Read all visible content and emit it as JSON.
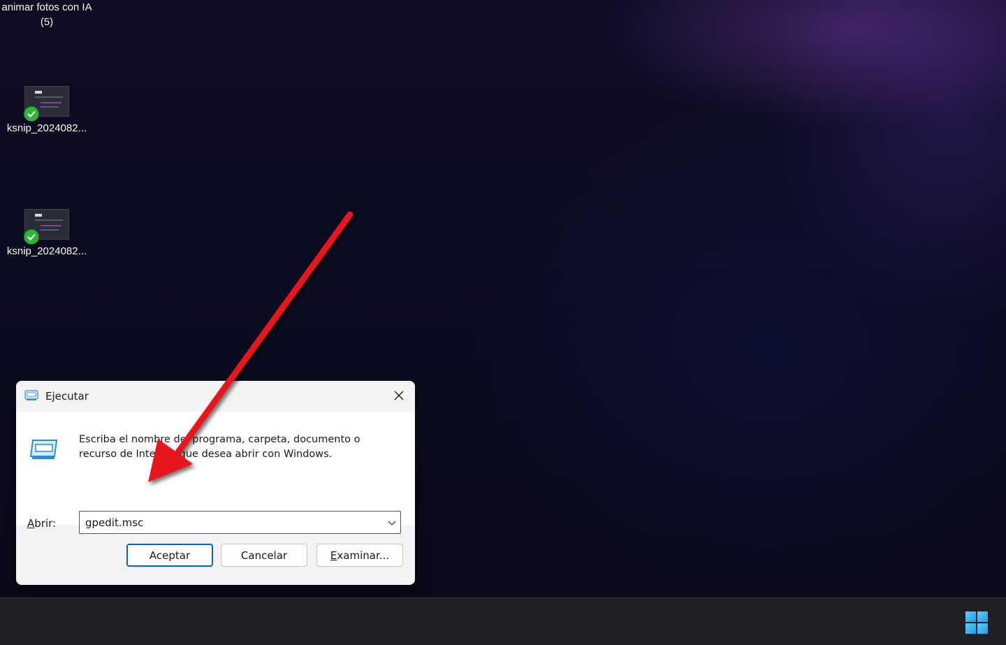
{
  "desktop": {
    "icons": [
      {
        "label": "animar fotos con IA (5)"
      },
      {
        "label": "ksnip_2024082..."
      },
      {
        "label": "ksnip_2024082..."
      }
    ]
  },
  "run_dialog": {
    "title": "Ejecutar",
    "title_icon": "run-icon",
    "description": "Escriba el nombre del programa, carpeta, documento o recurso de Internet que desea abrir con Windows.",
    "open_label_first": "A",
    "open_label_rest": "brir:",
    "open_value": "gpedit.msc",
    "buttons": {
      "ok": "Aceptar",
      "cancel": "Cancelar",
      "browse_first": "E",
      "browse_rest": "xaminar..."
    }
  },
  "annotation": {
    "arrow_color": "#e8141a"
  },
  "taskbar": {
    "start_icon": "windows-logo-icon",
    "accent": "#3fb6f0"
  }
}
